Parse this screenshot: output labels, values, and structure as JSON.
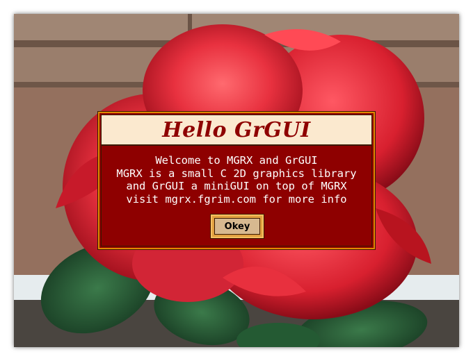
{
  "dialog": {
    "title": "Hello GrGUI",
    "message_lines": [
      "Welcome to MGRX and GrGUI",
      "MGRX is a small C 2D graphics library",
      "and GrGUI a miniGUI on top of MGRX",
      "visit mgrx.fgrim.com for more info"
    ],
    "button_label": "Okey"
  },
  "colors": {
    "dialog_body": "#8e0000",
    "title_bar": "#fbe9cf",
    "title_text": "#8e0000",
    "border_accent": "#e08a00",
    "button_face": "#d7b990"
  }
}
